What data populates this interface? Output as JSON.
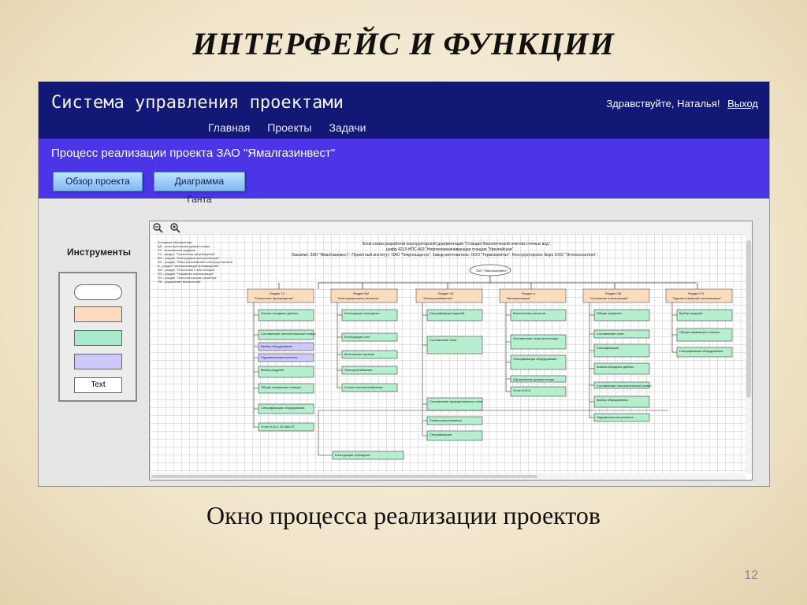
{
  "slide": {
    "title": "ИНТЕРФЕЙС И ФУНКЦИИ",
    "caption": "Окно процесса реализации проектов",
    "page_number": "12"
  },
  "app": {
    "title": "Система управления проектами",
    "greeting": "Здравствуйте, Наталья!",
    "logout": "Выход",
    "nav": [
      "Главная",
      "Проекты",
      "Задачи"
    ],
    "process_title": "Процесс реализации проекта ЗАО \"Ямалгазинвест\"",
    "buttons": {
      "overview": "Обзор проекта",
      "gantt": "Диаграмма Ганта"
    },
    "tools": {
      "label": "Инструменты",
      "text_tool": "Text"
    },
    "zoom": {
      "out_icon": "zoom-out-icon",
      "in_icon": "zoom-in-icon"
    },
    "diagram": {
      "legend": [
        "Условные обозначения:",
        "КД - конструкторская документация",
        "ТЗ - техническое задание",
        "ТХ - раздел \"Технология производства\"",
        "КМ - раздел \"Конструкции металлические\"",
        "ЭС - раздел \"Электроснабжение электроустановок\"",
        "А - раздел \"Автоматизация производства\"",
        "ОВ - раздел \"Отопление и вентиляция\"",
        "ПС - раздел \"Пожарная сигнализация\"",
        "ПЭ - раздел \"Технологические решения\"",
        "УВ - управление вычислений"
      ],
      "header": [
        "Блок-схема разработки конструкторской документации \"Станция биологической очистки сточных вод\",",
        "шифр 4213-НПС-403 \"Нефтеперекачивающая станция \"Уренгойская\"",
        "Заказчик: ЗАО \"Ямалгазинвест\". Проектный институт: ОАО \"Гипрогазцентр\". Завод-изготовитель: ООО \"Термокапитал\". Конструкторское бюро ООО \"Энтеконсалтинг\"."
      ],
      "top_node": "ЗАО \"Ямалгазинвест\"",
      "sections": [
        "Раздел ТХ",
        "Раздел КМ",
        "Раздел ЭС",
        "Раздел А",
        "Раздел ОВ",
        "Раздел ПЭ"
      ],
      "section_subtitles": [
        "\"Технология производства\"",
        "\"Конструкционные решения\"",
        "\"Электроснабжение\"",
        "\"Автоматизация\"",
        "\"Отопление и вентиляция\"",
        "\"Здание пожарной сигнализации\""
      ],
      "nodes": [
        "Анализ исходных данных",
        "Составление технологической схемы",
        "Выбор оборудования",
        "Гидравлические расчеты",
        "Выбор модулей",
        "Общие параметры станции",
        "Спецификация оборудования",
        "Отчет К.В.А. 06-086-ЕТ",
        "Конструкции проходных",
        "Конструкции стен",
        "Монтажные чертежи",
        "Электроснабжение",
        "Схемы электроснабжения",
        "Спецификация изделий",
        "Составление схем",
        "Составление функциональных схем",
        "Схемы расположения",
        "Спецификация",
        "Выполнение расчетов",
        "Составление схем вентиляции",
        "Спецификация оборудования",
        "Оформление документации",
        "Отчет К.В.А",
        "Общие сведения",
        "Составление схем",
        "Спецификация"
      ]
    }
  },
  "colors": {
    "header_bg": "#121876",
    "subheader_bg": "#4b35e6",
    "button_bg": "#8ec5f2",
    "node_green": "#b5efd0",
    "node_peach": "#fbdcbf",
    "node_lavender": "#cdc8ff"
  }
}
